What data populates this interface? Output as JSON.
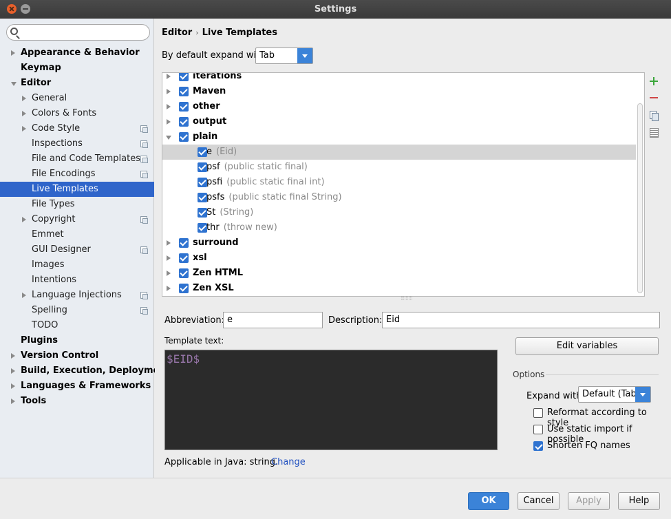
{
  "window": {
    "title": "Settings"
  },
  "search": {
    "placeholder": "",
    "value": ""
  },
  "sidebar": {
    "items": [
      {
        "label": "Appearance & Behavior",
        "level": 0,
        "arrow": "right"
      },
      {
        "label": "Keymap",
        "level": 0,
        "arrow": "none"
      },
      {
        "label": "Editor",
        "level": 0,
        "arrow": "down"
      },
      {
        "label": "General",
        "level": 1,
        "arrow": "right"
      },
      {
        "label": "Colors & Fonts",
        "level": 1,
        "arrow": "right"
      },
      {
        "label": "Code Style",
        "level": 1,
        "arrow": "right",
        "projectIcon": true
      },
      {
        "label": "Inspections",
        "level": 1,
        "arrow": "none",
        "projectIcon": true
      },
      {
        "label": "File and Code Templates",
        "level": 1,
        "arrow": "none",
        "projectIcon": true
      },
      {
        "label": "File Encodings",
        "level": 1,
        "arrow": "none",
        "projectIcon": true
      },
      {
        "label": "Live Templates",
        "level": 1,
        "arrow": "none",
        "selected": true
      },
      {
        "label": "File Types",
        "level": 1,
        "arrow": "none"
      },
      {
        "label": "Copyright",
        "level": 1,
        "arrow": "right",
        "projectIcon": true
      },
      {
        "label": "Emmet",
        "level": 1,
        "arrow": "none"
      },
      {
        "label": "GUI Designer",
        "level": 1,
        "arrow": "none",
        "projectIcon": true
      },
      {
        "label": "Images",
        "level": 1,
        "arrow": "none"
      },
      {
        "label": "Intentions",
        "level": 1,
        "arrow": "none"
      },
      {
        "label": "Language Injections",
        "level": 1,
        "arrow": "right",
        "projectIcon": true
      },
      {
        "label": "Spelling",
        "level": 1,
        "arrow": "none",
        "projectIcon": true
      },
      {
        "label": "TODO",
        "level": 1,
        "arrow": "none"
      },
      {
        "label": "Plugins",
        "level": 0,
        "arrow": "none"
      },
      {
        "label": "Version Control",
        "level": 0,
        "arrow": "right"
      },
      {
        "label": "Build, Execution, Deployment",
        "level": 0,
        "arrow": "right"
      },
      {
        "label": "Languages & Frameworks",
        "level": 0,
        "arrow": "right"
      },
      {
        "label": "Tools",
        "level": 0,
        "arrow": "right"
      }
    ]
  },
  "breadcrumb": {
    "part1": "Editor",
    "separator": "›",
    "part2": "Live Templates"
  },
  "expand": {
    "label": "By default expand with",
    "value": "Tab"
  },
  "templates": {
    "rows": [
      {
        "type": "group",
        "name": "iterations",
        "expanded": false,
        "checked": true
      },
      {
        "type": "group",
        "name": "Maven",
        "expanded": false,
        "checked": true
      },
      {
        "type": "group",
        "name": "other",
        "expanded": false,
        "checked": true
      },
      {
        "type": "group",
        "name": "output",
        "expanded": false,
        "checked": true
      },
      {
        "type": "group",
        "name": "plain",
        "expanded": true,
        "checked": true
      },
      {
        "type": "child",
        "name": "e",
        "desc": "(Eid)",
        "checked": true,
        "highlighted": true
      },
      {
        "type": "child",
        "name": "psf",
        "desc": "(public static final)",
        "checked": true
      },
      {
        "type": "child",
        "name": "psfi",
        "desc": "(public static final int)",
        "checked": true
      },
      {
        "type": "child",
        "name": "psfs",
        "desc": "(public static final String)",
        "checked": true
      },
      {
        "type": "child",
        "name": "St",
        "desc": "(String)",
        "checked": true
      },
      {
        "type": "child",
        "name": "thr",
        "desc": "(throw new)",
        "checked": true
      },
      {
        "type": "group",
        "name": "surround",
        "expanded": false,
        "checked": true
      },
      {
        "type": "group",
        "name": "xsl",
        "expanded": false,
        "checked": true
      },
      {
        "type": "group",
        "name": "Zen HTML",
        "expanded": false,
        "checked": true
      },
      {
        "type": "group",
        "name": "Zen XSL",
        "expanded": false,
        "checked": true
      }
    ]
  },
  "editorPanel": {
    "abbreviation_label": "Abbreviation:",
    "abbreviation_value": "e",
    "description_label": "Description:",
    "description_value": "Eid",
    "template_text_label": "Template text:",
    "template_text": "$EID$",
    "edit_variables": "Edit variables",
    "options_label": "Options",
    "expand_with_label": "Expand with",
    "expand_with_value": "Default (Tab)",
    "reformat_label": "Reformat according to style",
    "reformat_checked": false,
    "static_import_label": "Use static import if possible",
    "static_import_checked": false,
    "shorten_fq_label": "Shorten FQ names",
    "shorten_fq_checked": true,
    "applicable_text": "Applicable in Java: string.",
    "change_link": "Change"
  },
  "footer": {
    "ok": "OK",
    "cancel": "Cancel",
    "apply": "Apply",
    "help": "Help"
  },
  "colors": {
    "accent": "#3b83d8",
    "selection": "#2f65ca",
    "template_var": "#9876aa",
    "editor_bg": "#2b2b2b"
  }
}
